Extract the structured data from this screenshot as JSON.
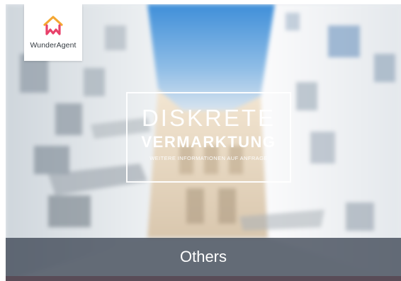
{
  "brand": {
    "name": "WunderAgent",
    "accent_color": "#e8416a",
    "accent_color_2": "#f4a733"
  },
  "promo": {
    "line1": "DISKRETE",
    "line2": "VERMARKTUNG",
    "line3": "WEITERE INFORMATIONEN AUF ANFRAGE"
  },
  "caption": {
    "label": "Others"
  },
  "colors": {
    "caption_bg": "#3e4654",
    "bottom_strip": "#594c57"
  }
}
